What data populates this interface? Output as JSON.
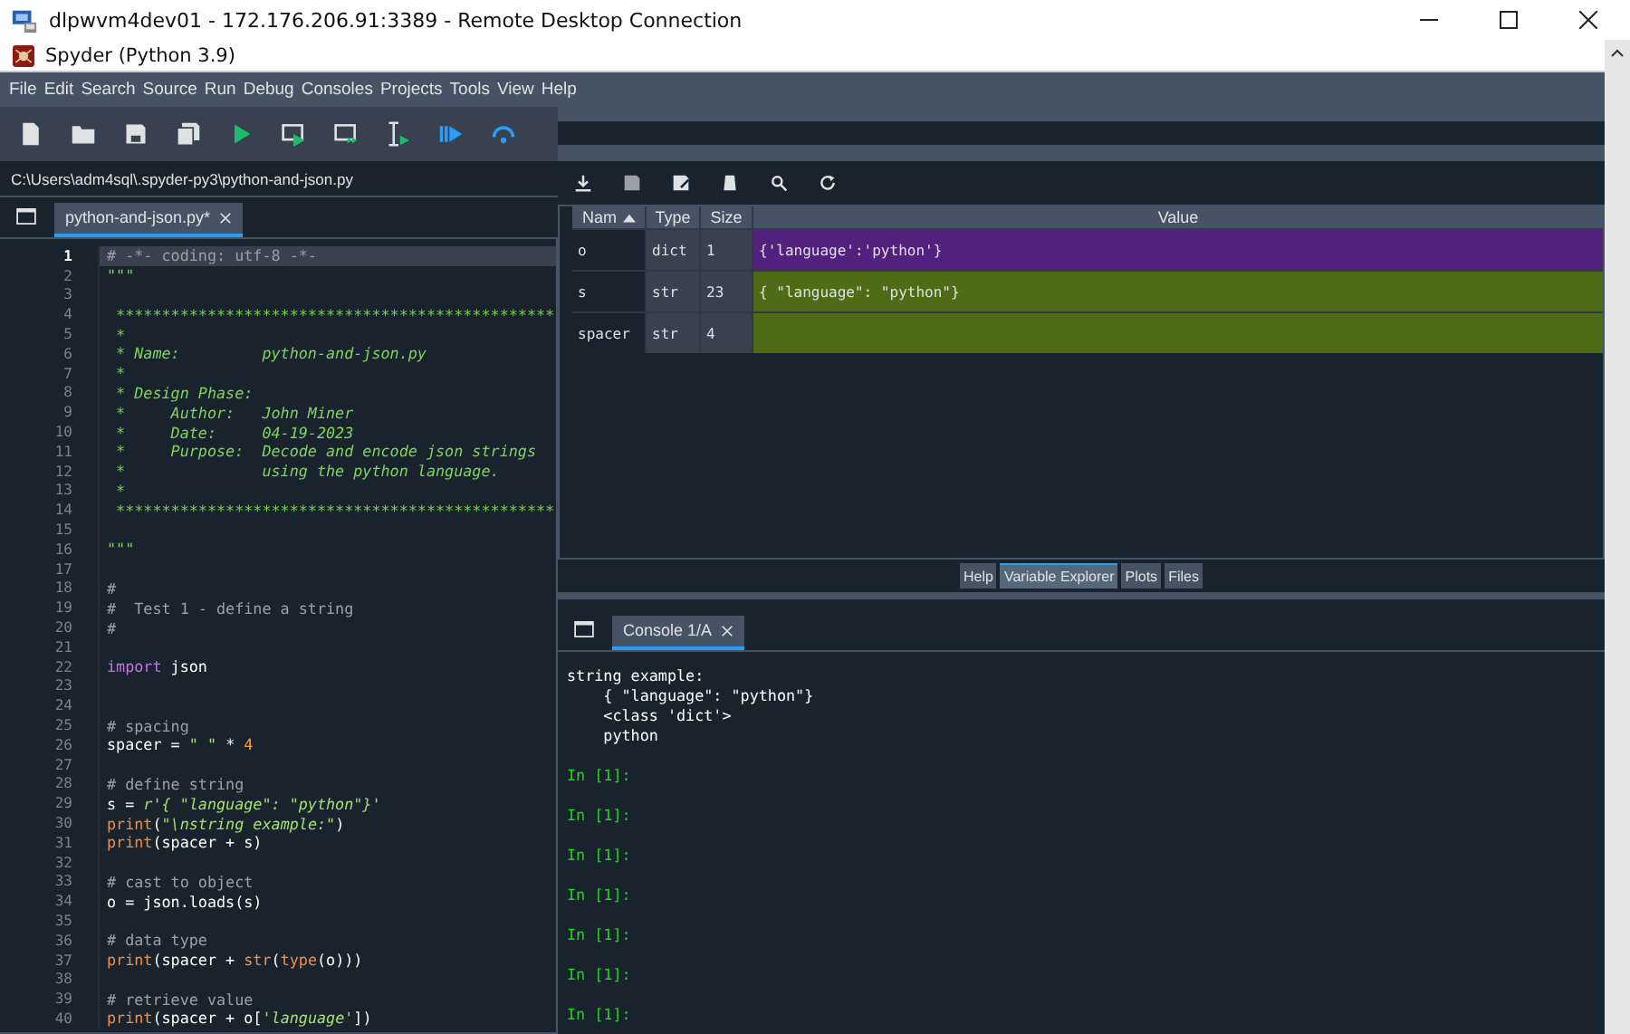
{
  "remote_window": {
    "title": "dlpwvm4dev01 - 172.176.206.91:3389 - Remote Desktop Connection"
  },
  "window": {
    "title": "Spyder (Python 3.9)"
  },
  "menu": [
    "File",
    "Edit",
    "Search",
    "Source",
    "Run",
    "Debug",
    "Consoles",
    "Projects",
    "Tools",
    "View",
    "Help"
  ],
  "path": "C:\\Users\\adm4sql\\.spyder-py3\\python-and-json.py",
  "editor": {
    "tabs": [
      {
        "label": "python-and-json.py*",
        "selected": true
      }
    ],
    "lines": [
      {
        "number": "1",
        "selected": true,
        "segments": [
          {
            "text": "# -*- coding: utf-8 -*-",
            "kind": "comment"
          }
        ]
      },
      {
        "number": "2",
        "selected": false,
        "segments": [
          {
            "text": "\"\"\"",
            "kind": "doc"
          }
        ]
      },
      {
        "number": "3",
        "selected": false
      },
      {
        "number": "4",
        "selected": false,
        "segments": [
          {
            "text": " ************************************************",
            "kind": "doc"
          }
        ]
      },
      {
        "number": "5",
        "selected": false,
        "segments": [
          {
            "text": " *",
            "kind": "doc"
          }
        ]
      },
      {
        "number": "6",
        "selected": false,
        "segments": [
          {
            "text": " * Name:         python-and-json.py",
            "kind": "doc"
          }
        ]
      },
      {
        "number": "7",
        "selected": false,
        "segments": [
          {
            "text": " *",
            "kind": "doc"
          }
        ]
      },
      {
        "number": "8",
        "selected": false,
        "segments": [
          {
            "text": " * Design Phase:",
            "kind": "doc"
          }
        ]
      },
      {
        "number": "9",
        "selected": false,
        "segments": [
          {
            "text": " *     Author:   John Miner",
            "kind": "doc"
          }
        ]
      },
      {
        "number": "10",
        "selected": false,
        "segments": [
          {
            "text": " *     Date:     04-19-2023",
            "kind": "doc"
          }
        ]
      },
      {
        "number": "11",
        "selected": false,
        "segments": [
          {
            "text": " *     Purpose:  Decode and encode json strings",
            "kind": "doc"
          }
        ]
      },
      {
        "number": "12",
        "selected": false,
        "segments": [
          {
            "text": " *               using the python language.",
            "kind": "doc"
          }
        ]
      },
      {
        "number": "13",
        "selected": false,
        "segments": [
          {
            "text": " *",
            "kind": "doc"
          }
        ]
      },
      {
        "number": "14",
        "selected": false,
        "segments": [
          {
            "text": " ************************************************",
            "kind": "doc"
          }
        ]
      },
      {
        "number": "15",
        "selected": false
      },
      {
        "number": "16",
        "selected": false,
        "segments": [
          {
            "text": "\"\"\"",
            "kind": "doc"
          }
        ]
      },
      {
        "number": "17",
        "selected": false
      },
      {
        "number": "18",
        "selected": false,
        "segments": [
          {
            "text": "#",
            "kind": "comment"
          }
        ]
      },
      {
        "number": "19",
        "selected": false,
        "segments": [
          {
            "text": "#  Test 1 - define a string",
            "kind": "comment"
          }
        ]
      },
      {
        "number": "20",
        "selected": false,
        "segments": [
          {
            "text": "#",
            "kind": "comment"
          }
        ]
      },
      {
        "number": "21",
        "selected": false
      },
      {
        "number": "22",
        "selected": false,
        "segments": [
          {
            "text": "import",
            "kind": "keyword"
          },
          {
            "text": " json",
            "kind": "plain"
          }
        ]
      },
      {
        "number": "23",
        "selected": false
      },
      {
        "number": "24",
        "selected": false
      },
      {
        "number": "25",
        "selected": false,
        "segments": [
          {
            "text": "# spacing",
            "kind": "comment"
          }
        ]
      },
      {
        "number": "26",
        "selected": false,
        "segments": [
          {
            "text": "spacer = ",
            "kind": "plain"
          },
          {
            "text": "\" \"",
            "kind": "string"
          },
          {
            "text": " * ",
            "kind": "plain"
          },
          {
            "text": "4",
            "kind": "number"
          }
        ]
      },
      {
        "number": "27",
        "selected": false
      },
      {
        "number": "28",
        "selected": false,
        "segments": [
          {
            "text": "# define string",
            "kind": "comment"
          }
        ]
      },
      {
        "number": "29",
        "selected": false,
        "segments": [
          {
            "text": "s = ",
            "kind": "plain"
          },
          {
            "text": "r'{ \"language\": \"python\"}'",
            "kind": "string"
          }
        ]
      },
      {
        "number": "30",
        "selected": false,
        "segments": [
          {
            "text": "print",
            "kind": "builtin"
          },
          {
            "text": "(",
            "kind": "plain"
          },
          {
            "text": "\"\\nstring example:\"",
            "kind": "string"
          },
          {
            "text": ")",
            "kind": "plain"
          }
        ]
      },
      {
        "number": "31",
        "selected": false,
        "segments": [
          {
            "text": "print",
            "kind": "builtin"
          },
          {
            "text": "(spacer + s)",
            "kind": "plain"
          }
        ]
      },
      {
        "number": "32",
        "selected": false
      },
      {
        "number": "33",
        "selected": false,
        "segments": [
          {
            "text": "# cast to object",
            "kind": "comment"
          }
        ]
      },
      {
        "number": "34",
        "selected": false,
        "segments": [
          {
            "text": "o = json.loads(s)",
            "kind": "plain"
          }
        ]
      },
      {
        "number": "35",
        "selected": false
      },
      {
        "number": "36",
        "selected": false,
        "segments": [
          {
            "text": "# data type",
            "kind": "comment"
          }
        ]
      },
      {
        "number": "37",
        "selected": false,
        "segments": [
          {
            "text": "print",
            "kind": "builtin"
          },
          {
            "text": "(spacer + ",
            "kind": "plain"
          },
          {
            "text": "str",
            "kind": "builtin"
          },
          {
            "text": "(",
            "kind": "plain"
          },
          {
            "text": "type",
            "kind": "builtin"
          },
          {
            "text": "(o)))",
            "kind": "plain"
          }
        ]
      },
      {
        "number": "38",
        "selected": false
      },
      {
        "number": "39",
        "selected": false,
        "segments": [
          {
            "text": "# retrieve value",
            "kind": "comment"
          }
        ]
      },
      {
        "number": "40",
        "selected": false,
        "segments": [
          {
            "text": "print",
            "kind": "builtin"
          },
          {
            "text": "(spacer + o[",
            "kind": "plain"
          },
          {
            "text": "'language'",
            "kind": "string"
          },
          {
            "text": "])",
            "kind": "plain"
          }
        ]
      }
    ]
  },
  "variables": {
    "columns": [
      "Nam",
      "Type",
      "Size",
      "Value"
    ],
    "rows": [
      {
        "name": "o",
        "type": "dict",
        "size": "1",
        "value": "{'language':'python'}",
        "color": "#52217e"
      },
      {
        "name": "s",
        "type": "str",
        "size": "23",
        "value": "{ \"language\": \"python\"}",
        "color": "#4e6b15"
      },
      {
        "name": "spacer",
        "type": "str",
        "size": "4",
        "color": "#4e6b15"
      }
    ]
  },
  "pane_tabs": [
    {
      "label": "Help",
      "selected": false
    },
    {
      "label": "Variable Explorer",
      "selected": true
    },
    {
      "label": "Plots",
      "selected": false
    },
    {
      "label": "Files",
      "selected": false
    }
  ],
  "console": {
    "tabs": [
      {
        "label": "Console 1/A",
        "selected": true
      }
    ],
    "lines": [
      {
        "text": "string example:",
        "kind": "output"
      },
      {
        "text": "    { \"language\": \"python\"}",
        "kind": "output"
      },
      {
        "text": "    <class 'dict'>",
        "kind": "output"
      },
      {
        "text": "    python",
        "kind": "output"
      },
      {
        "text": "In [1]:",
        "kind": "prompt"
      },
      {
        "text": "In [1]:",
        "kind": "prompt"
      },
      {
        "text": "In [1]:",
        "kind": "prompt"
      },
      {
        "text": "In [1]:",
        "kind": "prompt"
      },
      {
        "text": "In [1]:",
        "kind": "prompt"
      },
      {
        "text": "In [1]:",
        "kind": "prompt"
      },
      {
        "text": "In [1]:",
        "kind": "prompt"
      }
    ]
  }
}
